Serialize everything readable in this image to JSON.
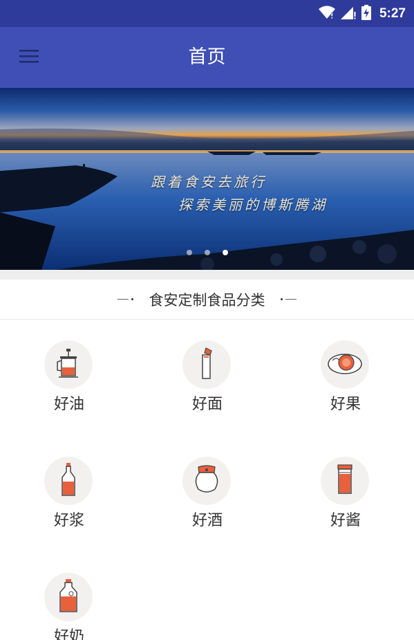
{
  "status_bar": {
    "time": "5:27",
    "icons": [
      "wifi-icon",
      "signal-icon",
      "battery-charging-icon"
    ]
  },
  "app_bar": {
    "title": "首页",
    "menu_icon": "menu-icon"
  },
  "banner": {
    "caption_line1": "跟着食安去旅行",
    "caption_line2": "探索美丽的博斯腾湖",
    "slide_count": 3,
    "active_slide": 3
  },
  "section": {
    "title": "食安定制食品分类"
  },
  "categories": [
    {
      "label": "好油",
      "icon": "oil-press-icon"
    },
    {
      "label": "好面",
      "icon": "flour-bag-icon"
    },
    {
      "label": "好果",
      "icon": "fruit-plate-icon"
    },
    {
      "label": "好浆",
      "icon": "juice-bottle-icon"
    },
    {
      "label": "好酒",
      "icon": "wine-jar-icon"
    },
    {
      "label": "好酱",
      "icon": "sauce-jar-icon"
    },
    {
      "label": "好奶",
      "icon": "milk-bottle-icon"
    }
  ],
  "colors": {
    "status_bar": "#2f3b9b",
    "app_bar": "#3f4fb5",
    "icon_accent": "#e8603c",
    "icon_circle": "#f3f1ef"
  }
}
